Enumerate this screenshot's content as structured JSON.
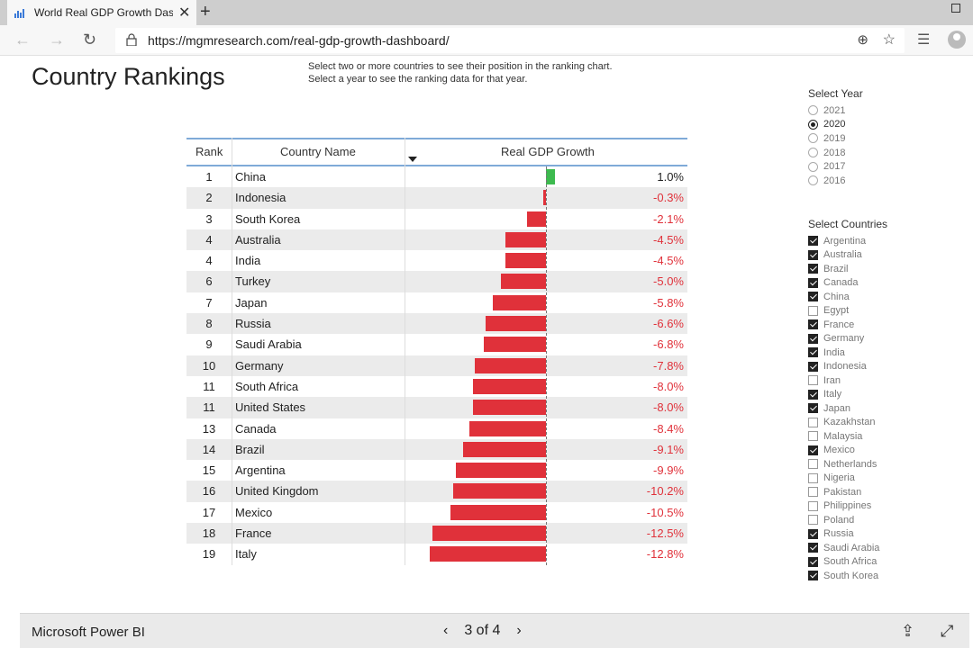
{
  "browser": {
    "tab_title": "World Real GDP Growth Dashboard",
    "new_tab_label": "+",
    "url": "https://mgmresearch.com/real-gdp-growth-dashboard/"
  },
  "page": {
    "title": "Country Rankings",
    "instructions": [
      "Select two or more countries to see their position in the ranking chart.",
      "Select a year to see the ranking data for that year."
    ]
  },
  "table": {
    "headers": {
      "rank": "Rank",
      "country": "Country Name",
      "growth": "Real GDP Growth"
    },
    "rows": [
      {
        "rank": "1",
        "country": "China",
        "value": 1.0,
        "label": "1.0%"
      },
      {
        "rank": "2",
        "country": "Indonesia",
        "value": -0.3,
        "label": "-0.3%"
      },
      {
        "rank": "3",
        "country": "South Korea",
        "value": -2.1,
        "label": "-2.1%"
      },
      {
        "rank": "4",
        "country": "Australia",
        "value": -4.5,
        "label": "-4.5%"
      },
      {
        "rank": "4",
        "country": "India",
        "value": -4.5,
        "label": "-4.5%"
      },
      {
        "rank": "6",
        "country": "Turkey",
        "value": -5.0,
        "label": "-5.0%"
      },
      {
        "rank": "7",
        "country": "Japan",
        "value": -5.8,
        "label": "-5.8%"
      },
      {
        "rank": "8",
        "country": "Russia",
        "value": -6.6,
        "label": "-6.6%"
      },
      {
        "rank": "9",
        "country": "Saudi Arabia",
        "value": -6.8,
        "label": "-6.8%"
      },
      {
        "rank": "10",
        "country": "Germany",
        "value": -7.8,
        "label": "-7.8%"
      },
      {
        "rank": "11",
        "country": "South Africa",
        "value": -8.0,
        "label": "-8.0%"
      },
      {
        "rank": "11",
        "country": "United States",
        "value": -8.0,
        "label": "-8.0%"
      },
      {
        "rank": "13",
        "country": "Canada",
        "value": -8.4,
        "label": "-8.4%"
      },
      {
        "rank": "14",
        "country": "Brazil",
        "value": -9.1,
        "label": "-9.1%"
      },
      {
        "rank": "15",
        "country": "Argentina",
        "value": -9.9,
        "label": "-9.9%"
      },
      {
        "rank": "16",
        "country": "United Kingdom",
        "value": -10.2,
        "label": "-10.2%"
      },
      {
        "rank": "17",
        "country": "Mexico",
        "value": -10.5,
        "label": "-10.5%"
      },
      {
        "rank": "18",
        "country": "France",
        "value": -12.5,
        "label": "-12.5%"
      },
      {
        "rank": "19",
        "country": "Italy",
        "value": -12.8,
        "label": "-12.8%"
      }
    ],
    "colors": {
      "positive": "#3dba4f",
      "negative": "#e0313a"
    }
  },
  "year_filter": {
    "title": "Select Year",
    "options": [
      {
        "label": "2021",
        "selected": false
      },
      {
        "label": "2020",
        "selected": true
      },
      {
        "label": "2019",
        "selected": false
      },
      {
        "label": "2018",
        "selected": false
      },
      {
        "label": "2017",
        "selected": false
      },
      {
        "label": "2016",
        "selected": false
      }
    ]
  },
  "country_filter": {
    "title": "Select Countries",
    "options": [
      {
        "label": "Argentina",
        "checked": true
      },
      {
        "label": "Australia",
        "checked": true
      },
      {
        "label": "Brazil",
        "checked": true
      },
      {
        "label": "Canada",
        "checked": true
      },
      {
        "label": "China",
        "checked": true
      },
      {
        "label": "Egypt",
        "checked": false
      },
      {
        "label": "France",
        "checked": true
      },
      {
        "label": "Germany",
        "checked": true
      },
      {
        "label": "India",
        "checked": true
      },
      {
        "label": "Indonesia",
        "checked": true
      },
      {
        "label": "Iran",
        "checked": false
      },
      {
        "label": "Italy",
        "checked": true
      },
      {
        "label": "Japan",
        "checked": true
      },
      {
        "label": "Kazakhstan",
        "checked": false
      },
      {
        "label": "Malaysia",
        "checked": false
      },
      {
        "label": "Mexico",
        "checked": true
      },
      {
        "label": "Netherlands",
        "checked": false
      },
      {
        "label": "Nigeria",
        "checked": false
      },
      {
        "label": "Pakistan",
        "checked": false
      },
      {
        "label": "Philippines",
        "checked": false
      },
      {
        "label": "Poland",
        "checked": false
      },
      {
        "label": "Russia",
        "checked": true
      },
      {
        "label": "Saudi Arabia",
        "checked": true
      },
      {
        "label": "South Africa",
        "checked": true
      },
      {
        "label": "South Korea",
        "checked": true
      }
    ]
  },
  "footer": {
    "brand": "Microsoft Power BI",
    "page_indicator": "3 of 4"
  }
}
